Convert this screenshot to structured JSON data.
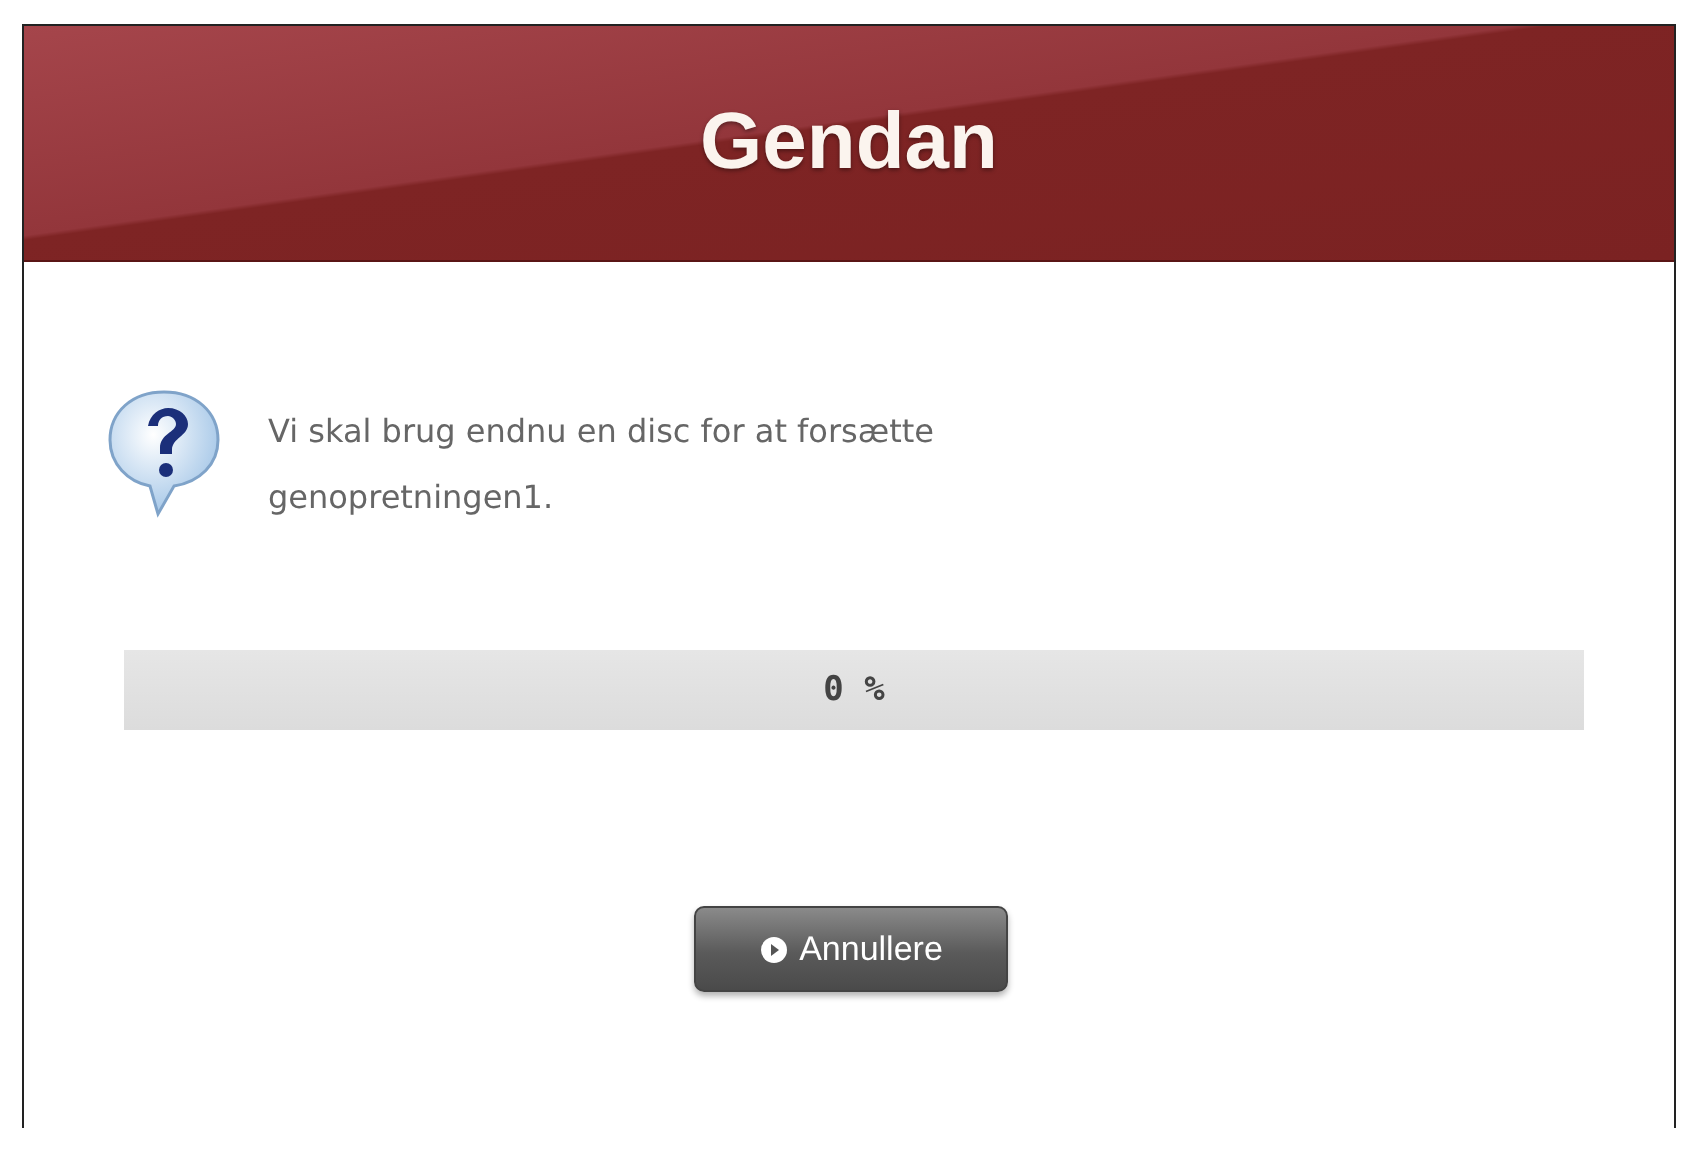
{
  "window": {
    "title": "Gendan"
  },
  "message": {
    "text": "Vi skal brug endnu en disc for at forsætte genopretningen1."
  },
  "progress": {
    "level": 0,
    "reading": "0 %"
  },
  "buttons": [
    {
      "label": "Annullere",
      "kind": "cancel"
    }
  ]
}
